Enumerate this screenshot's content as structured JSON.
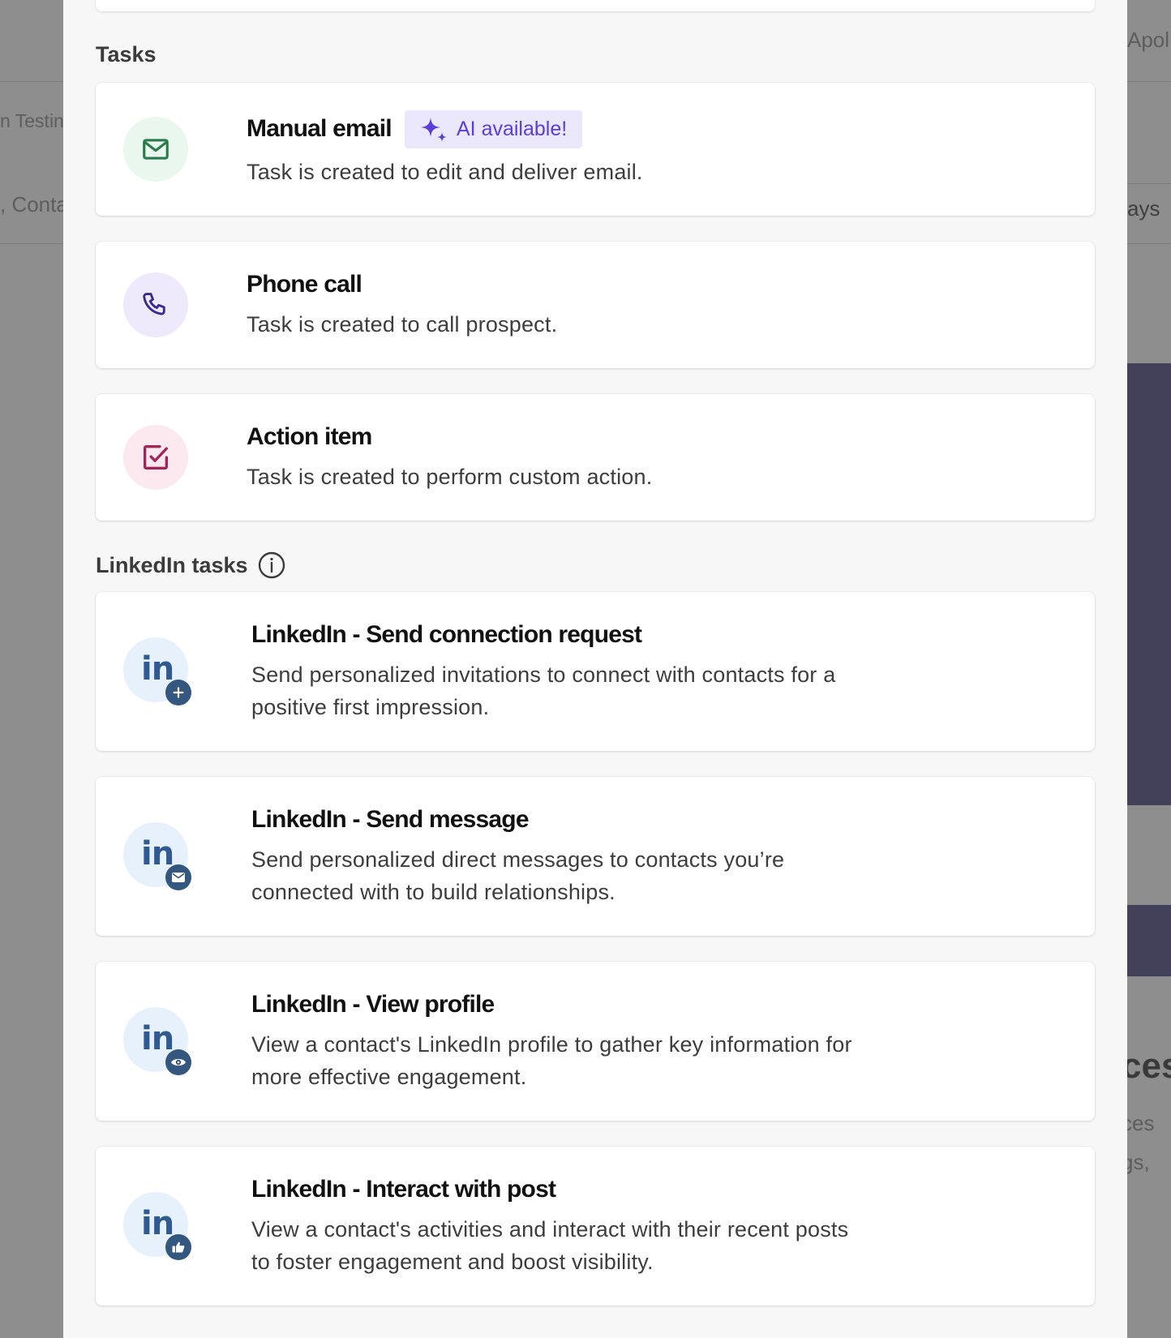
{
  "background": {
    "left_text_1": "n Testin",
    "left_text_2": ", Conta",
    "right_text_1": "Apol",
    "right_text_2": "ays",
    "right_text_3": "ces",
    "right_text_4": "ces",
    "right_text_5": "gs,"
  },
  "sections": {
    "tasks_title": "Tasks",
    "linkedin_title": "LinkedIn tasks"
  },
  "tasks": [
    {
      "title": "Manual email",
      "description": "Task is created to edit and deliver email.",
      "badge": "AI available!",
      "icon": "mail-icon"
    },
    {
      "title": "Phone call",
      "description": "Task is created to call prospect.",
      "icon": "phone-icon"
    },
    {
      "title": "Action item",
      "description": "Task is created to perform custom action.",
      "icon": "checkbox-icon"
    }
  ],
  "linkedin_tasks": [
    {
      "title": "LinkedIn - Send connection request",
      "description_line1": "Send personalized invitations to connect with contacts for a",
      "description_line2": "positive first impression.",
      "logo": "in",
      "badge_icon": "plus-icon"
    },
    {
      "title": "LinkedIn - Send message",
      "description_line1": "Send personalized direct messages to contacts you’re",
      "description_line2": "connected with to build relationships.",
      "logo": "in",
      "badge_icon": "envelope-icon"
    },
    {
      "title": "LinkedIn - View profile",
      "description_line1": "View a contact's LinkedIn profile to gather key information for",
      "description_line2": "more effective engagement.",
      "logo": "in",
      "badge_icon": "eye-icon"
    },
    {
      "title": "LinkedIn - Interact with post",
      "description_line1": "View a contact's activities and interact with their recent posts",
      "description_line2": "to foster engagement and boost visibility.",
      "logo": "in",
      "badge_icon": "thumbs-up-icon"
    }
  ],
  "colors": {
    "email_icon_bg": "#e9f7ee",
    "email_icon": "#2b7a4b",
    "phone_icon_bg": "#eeeafb",
    "phone_icon": "#3b2a8c",
    "action_icon_bg": "#fbe9ef",
    "action_icon": "#a3245a",
    "ai_badge_bg": "#ebe7fd",
    "ai_badge_text": "#5b3ed6",
    "linkedin_blue": "#2f5a92",
    "modal_bg": "#f7f7f7",
    "overlay_panel": "#43415a"
  }
}
